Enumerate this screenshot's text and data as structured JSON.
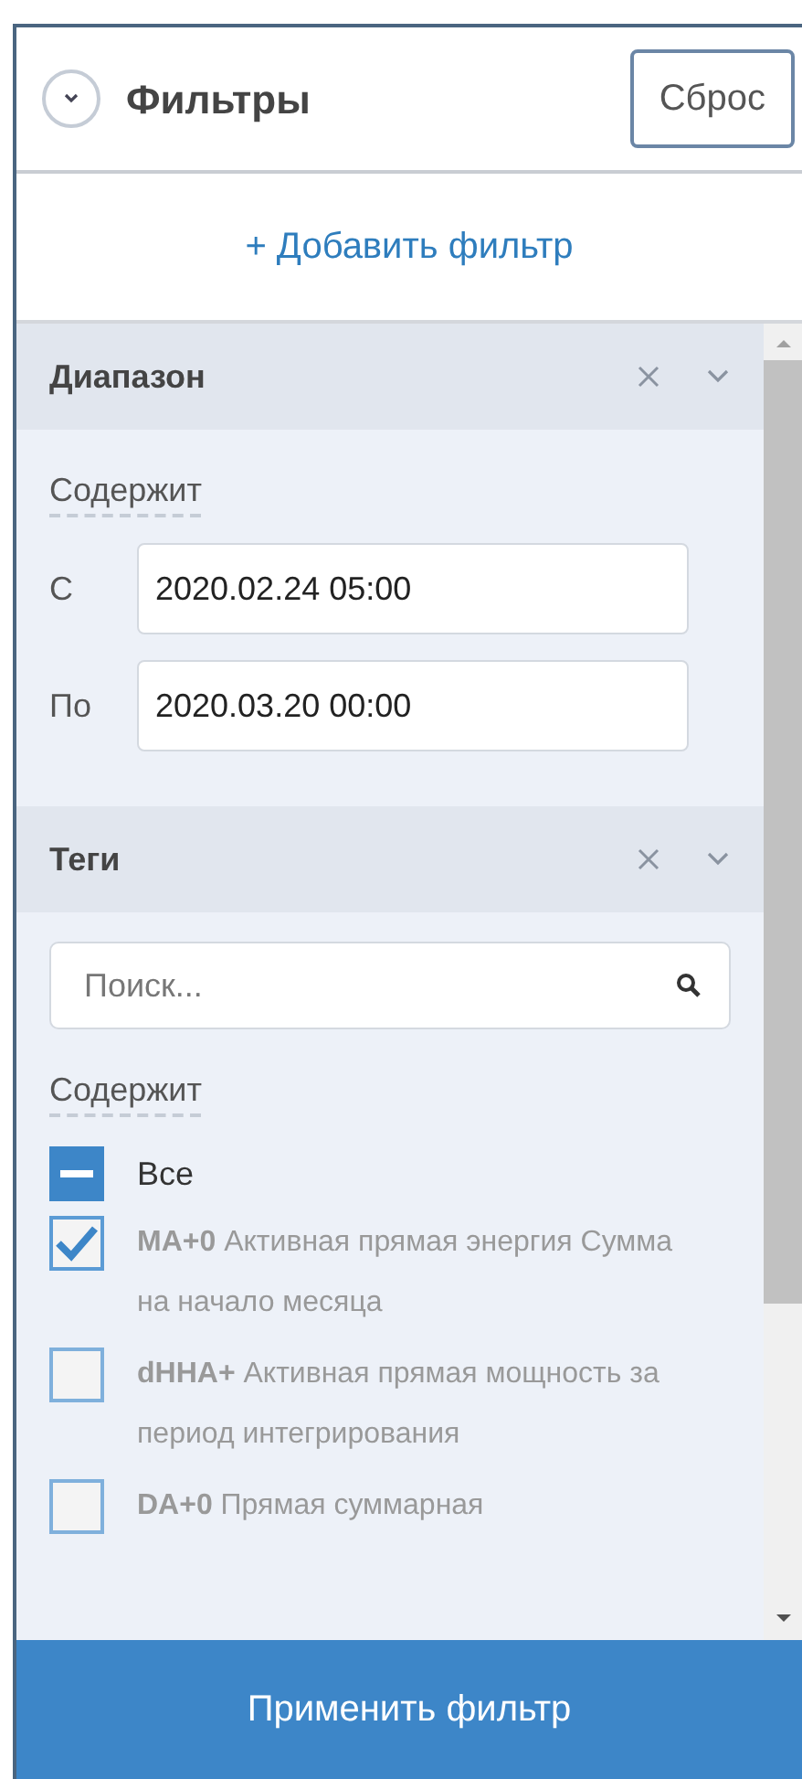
{
  "header": {
    "title": "Фильтры",
    "reset_button": "Сброс",
    "collapsed": false
  },
  "add_filter": "+ Добавить фильтр",
  "filters": [
    {
      "kind": "range",
      "title": "Диапазон",
      "mode": "Содержит",
      "fields": [
        {
          "label": "С",
          "value": "2020.02.24 05:00"
        },
        {
          "label": "По",
          "value": "2020.03.20 00:00"
        }
      ]
    },
    {
      "kind": "tags",
      "title": "Теги",
      "search_placeholder": "Поиск...",
      "mode": "Содержит",
      "items": [
        {
          "label": "Все",
          "indeterminate": true
        },
        {
          "label": "**MA+0** Активная прямая энергия Сумма на начало месяца",
          "checked": true
        },
        {
          "label": "**dHHA+**  Активная прямая мощность за период интегрирования",
          "checked": false
        },
        {
          "label": "**DA+0** Прямая суммарная",
          "checked": false
        }
      ]
    }
  ],
  "apply_button": "Применить фильтр"
}
